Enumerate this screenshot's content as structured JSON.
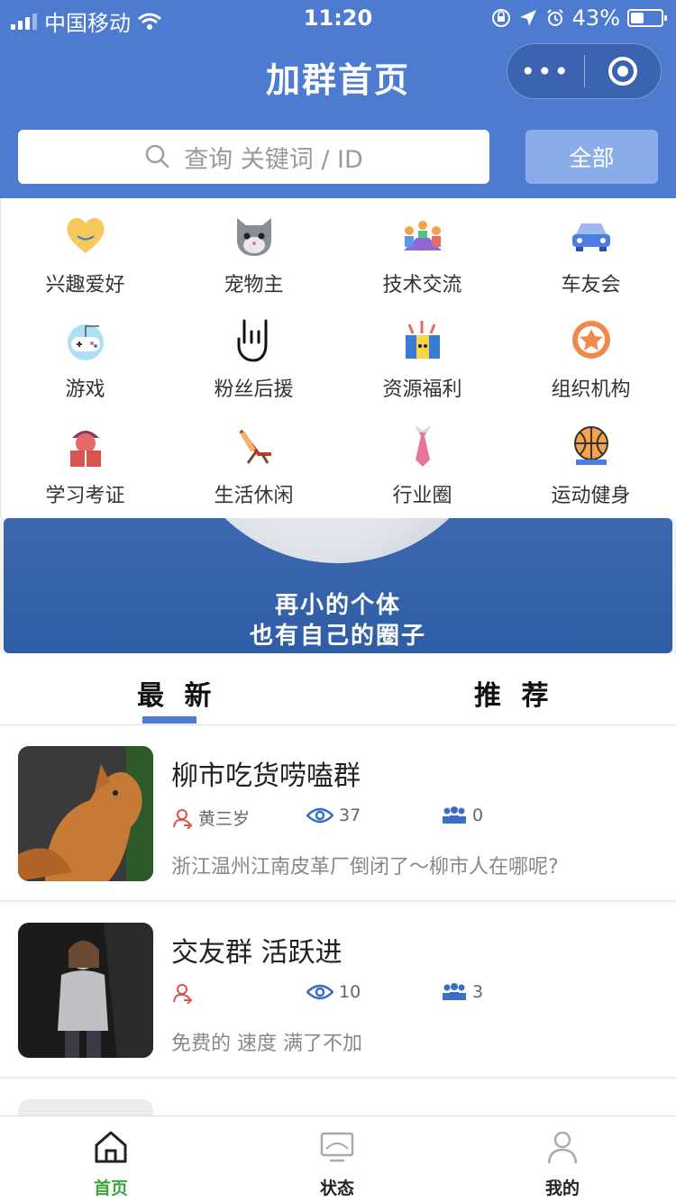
{
  "status_bar": {
    "carrier": "中国移动",
    "time": "11:20",
    "battery": "43%",
    "battery_level": 0.43
  },
  "nav": {
    "title": "加群首页",
    "more_glyph": "•••"
  },
  "search": {
    "placeholder": "查询 关键词 / ID",
    "all_button": "全部"
  },
  "categories": [
    {
      "label": "兴趣爱好",
      "icon": "heart-icon"
    },
    {
      "label": "宠物主",
      "icon": "cat-icon"
    },
    {
      "label": "技术交流",
      "icon": "people-meeting-icon"
    },
    {
      "label": "车友会",
      "icon": "car-icon"
    },
    {
      "label": "游戏",
      "icon": "gamepad-icon"
    },
    {
      "label": "粉丝后援",
      "icon": "rock-hand-icon"
    },
    {
      "label": "资源福利",
      "icon": "gift-box-icon"
    },
    {
      "label": "组织机构",
      "icon": "badge-icon"
    },
    {
      "label": "学习考证",
      "icon": "student-icon"
    },
    {
      "label": "生活休闲",
      "icon": "lounge-chair-icon"
    },
    {
      "label": "行业圈",
      "icon": "necktie-icon"
    },
    {
      "label": "运动健身",
      "icon": "basketball-icon"
    }
  ],
  "banner": {
    "line1": "再小的个体",
    "line2": "也有自己的圈子"
  },
  "tabs": {
    "latest": "最 新",
    "recommended": "推 荐"
  },
  "groups": [
    {
      "name": "柳市吃货唠嗑群",
      "owner": "黄三岁",
      "views": "37",
      "members": "0",
      "description": "浙江温州江南皮革厂倒闭了～柳市人在哪呢?"
    },
    {
      "name": "交友群 活跃进",
      "owner": "",
      "views": "10",
      "members": "3",
      "description": "免费的 速度 满了不加"
    }
  ],
  "tabbar": {
    "home": "首页",
    "status": "状态",
    "mine": "我的"
  },
  "colors": {
    "primary": "#4c7bd0",
    "active_tab": "#3aa63a",
    "accent_red": "#d9534f"
  }
}
